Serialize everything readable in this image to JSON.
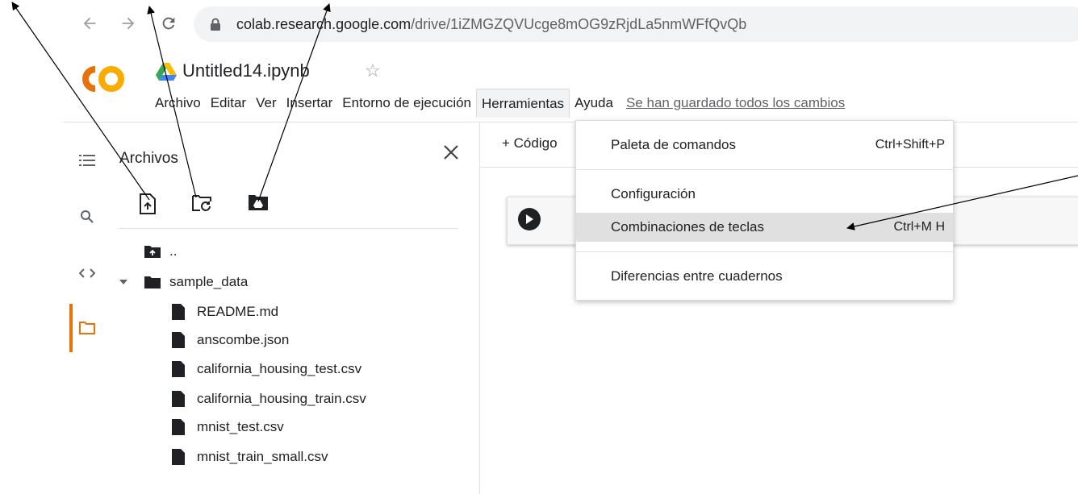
{
  "browser": {
    "url_host": "colab.research.google.com",
    "url_path": "/drive/1iZMGZQVUcge8mOG9zRjdLa5nmWFfQvQb"
  },
  "notebook": {
    "logo_text": "CO",
    "title": "Untitled14.ipynb"
  },
  "menu": {
    "items": [
      "Archivo",
      "Editar",
      "Ver",
      "Insertar",
      "Entorno de ejecución",
      "Herramientas",
      "Ayuda"
    ],
    "save_status": "Se han guardado todos los cambios"
  },
  "sidebar": {
    "panel_title": "Archivos",
    "tree": {
      "parent": "..",
      "folder": "sample_data",
      "files": [
        "README.md",
        "anscombe.json",
        "california_housing_test.csv",
        "california_housing_train.csv",
        "mnist_test.csv",
        "mnist_train_small.csv"
      ]
    }
  },
  "main": {
    "add_code_label": "+ Código"
  },
  "tools_menu": {
    "items": [
      {
        "label": "Paleta de comandos",
        "shortcut": "Ctrl+Shift+P"
      },
      {
        "label": "Configuración",
        "shortcut": ""
      },
      {
        "label": "Combinaciones de teclas",
        "shortcut": "Ctrl+M H"
      },
      {
        "label": "Diferencias entre cuadernos",
        "shortcut": ""
      }
    ]
  },
  "colors": {
    "accent": "#e8710a",
    "logo_orange": "#f9ab00",
    "logo_dark": "#e8710a"
  }
}
